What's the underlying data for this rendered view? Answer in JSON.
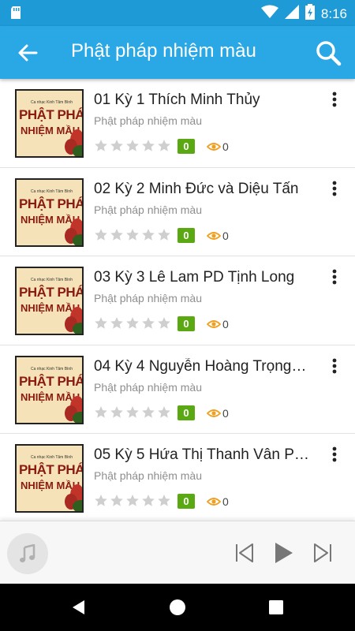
{
  "status": {
    "time": "8:16",
    "battery": "battery-charging-icon",
    "wifi": "wifi-icon",
    "signal": "signal-icon",
    "sd": "sd-card-icon"
  },
  "appbar": {
    "title": "Phật pháp nhiệm màu",
    "bg": "#2aa8e6"
  },
  "thumb": {
    "small_text": "Ca nhạc Kinh Tâm Bình",
    "line1": "PHẬT PHÁP",
    "line2": "NHIỆM MẦU"
  },
  "items": [
    {
      "title": "01 Kỳ 1 Thích Minh Thủy",
      "subtitle": "Phật pháp nhiệm màu",
      "rating": "0",
      "views": "0"
    },
    {
      "title": "02 Kỳ 2 Minh Đức và Diệu Tấn",
      "subtitle": "Phật pháp nhiệm màu",
      "rating": "0",
      "views": "0"
    },
    {
      "title": "03 Kỳ 3 Lê Lam PD Tịnh Long",
      "subtitle": "Phật pháp nhiệm màu",
      "rating": "0",
      "views": "0"
    },
    {
      "title": "04 Kỳ 4 Nguyễn Hoàng Trọng…",
      "subtitle": "Phật pháp nhiệm màu",
      "rating": "0",
      "views": "0"
    },
    {
      "title": "05 Kỳ 5 Hứa Thị Thanh Vân P…",
      "subtitle": "Phật pháp nhiệm màu",
      "rating": "0",
      "views": "0"
    }
  ],
  "colors": {
    "badge": "#5aa812",
    "eye": "#f0a020",
    "star": "#cfcfcf"
  }
}
